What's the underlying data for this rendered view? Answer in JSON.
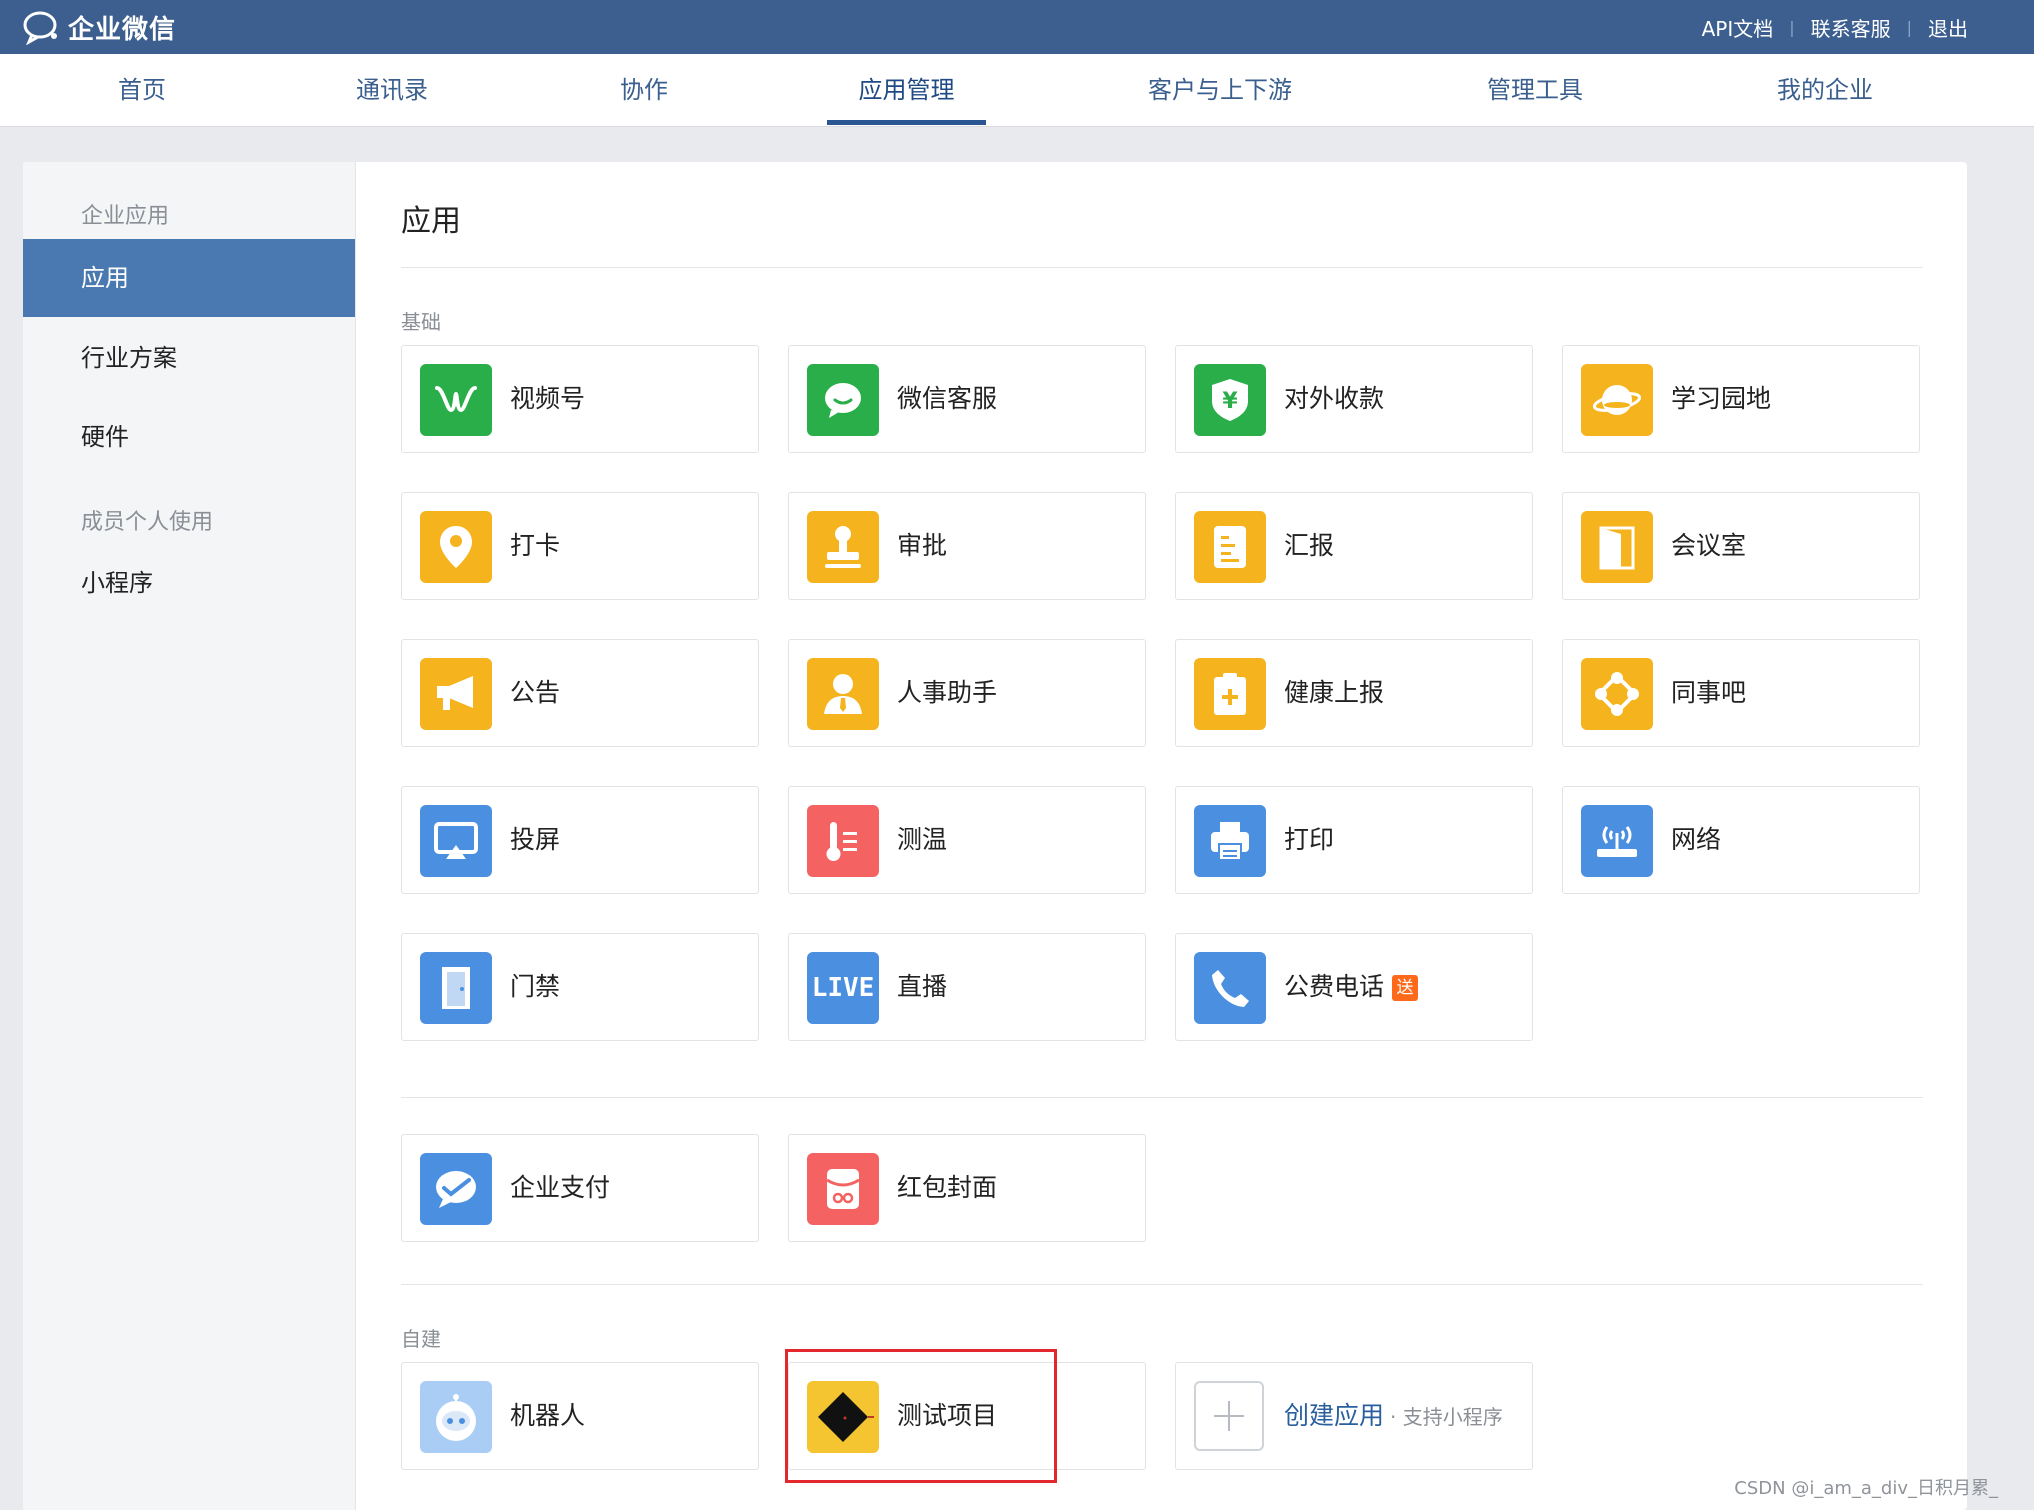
{
  "brand": {
    "name": "企业微信"
  },
  "toplinks": [
    "API文档",
    "联系客服",
    "退出"
  ],
  "nav": [
    "首页",
    "通讯录",
    "协作",
    "应用管理",
    "客户与上下游",
    "管理工具",
    "我的企业"
  ],
  "sidebar": {
    "group1": "企业应用",
    "items1": [
      "应用",
      "行业方案",
      "硬件"
    ],
    "group2": "成员个人使用",
    "items2": [
      "小程序"
    ]
  },
  "main": {
    "title": "应用",
    "section_basic": "基础",
    "basic_apps": [
      "视频号",
      "微信客服",
      "对外收款",
      "学习园地",
      "打卡",
      "审批",
      "汇报",
      "会议室",
      "公告",
      "人事助手",
      "健康上报",
      "同事吧",
      "投屏",
      "测温",
      "打印",
      "网络",
      "门禁",
      "直播",
      "公费电话"
    ],
    "badge_free": "送",
    "payment_apps": [
      "企业支付",
      "红包封面"
    ],
    "section_custom": "自建",
    "custom_apps": [
      "机器人",
      "测试项目"
    ],
    "create_app": {
      "label": "创建应用",
      "sub": "· 支持小程序"
    },
    "live_icon_text": "LIVE"
  },
  "colors": {
    "topbar": "#3c5f8f",
    "green": "#2aae4a",
    "yellow": "#f5b31d",
    "blue": "#4a8fe0",
    "red": "#f46262",
    "highlight": "#e3272c"
  },
  "watermark": "CSDN @i_am_a_div_日积月累_"
}
